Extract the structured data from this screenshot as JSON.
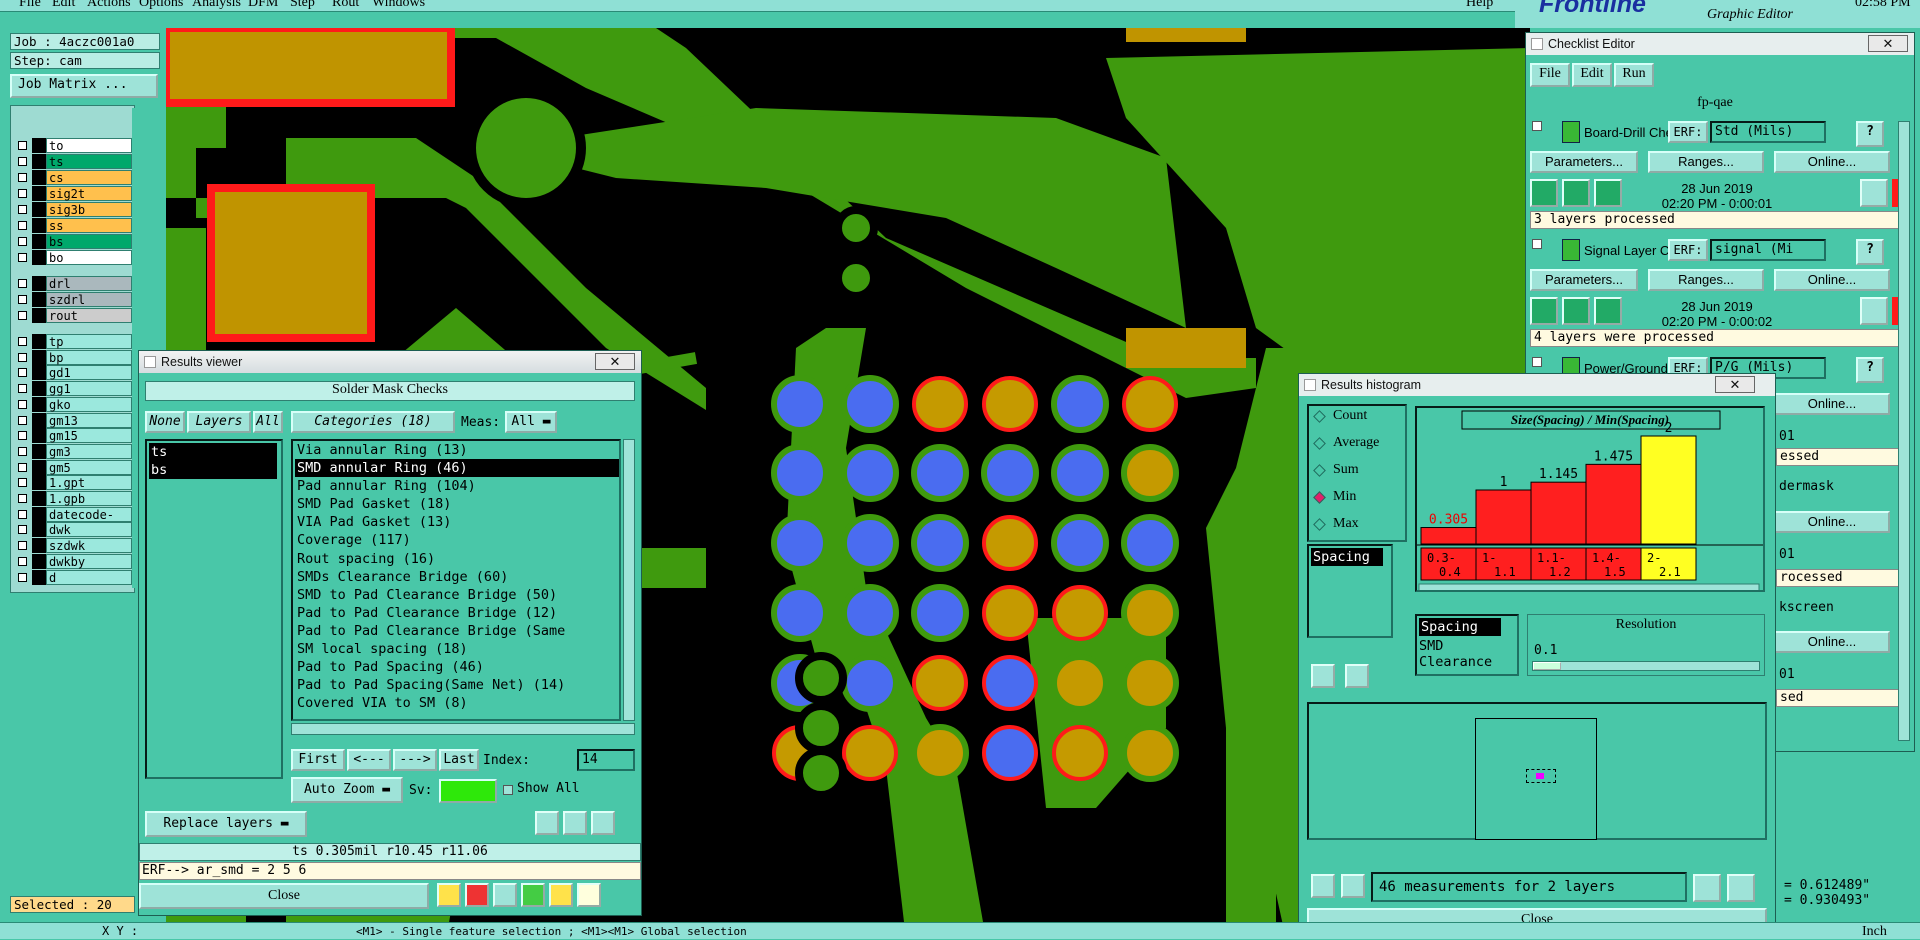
{
  "menubar": {
    "items": [
      "File",
      "Edit",
      "Actions",
      "Options",
      "Analysis",
      "DFM",
      "Step",
      "Rout",
      "Windows"
    ],
    "help": "Help",
    "brand": "Frontline",
    "subtitle": "Graphic Editor",
    "clock": "02:58 PM"
  },
  "left_panel": {
    "job": "Job : 4aczc001a0",
    "step": "Step: cam",
    "job_matrix_button": "Job Matrix ...",
    "selected": "Selected : 20",
    "layers_group1": [
      {
        "name": "to",
        "color": "#ffffff"
      },
      {
        "name": "ts",
        "color": "#00a86b"
      },
      {
        "name": "cs",
        "color": "#ffc04d"
      },
      {
        "name": "sig2t",
        "color": "#ffc04d"
      },
      {
        "name": "sig3b",
        "color": "#ffc04d"
      },
      {
        "name": "ss",
        "color": "#ffc04d"
      },
      {
        "name": "bs",
        "color": "#00a86b"
      },
      {
        "name": "bo",
        "color": "#ffffff"
      }
    ],
    "layers_group2": [
      {
        "name": "drl",
        "color": "#aab8bd"
      },
      {
        "name": "szdrl",
        "color": "#aab8bd"
      },
      {
        "name": "rout",
        "color": "#cccccc"
      }
    ],
    "layers_group3": [
      "tp",
      "bp",
      "gd1",
      "gg1",
      "gko",
      "gm13",
      "gm15",
      "gm3",
      "gm5",
      "1.gpt",
      "1.gpb",
      "datecode-pts",
      "dwk",
      "szdwk",
      "dwkby",
      "d"
    ]
  },
  "bottom_bar": {
    "hint": "<M1> - Single feature selection ; <M1><M1> Global selection",
    "xy_label": "X Y :",
    "units": "Inch",
    "coord_x": "= 0.612489\"",
    "coord_y": "= 0.930493\""
  },
  "results_viewer": {
    "title": "Results viewer",
    "header": "Solder Mask Checks",
    "none_btn": "None",
    "layers_btn": "Layers",
    "all_btn": "All",
    "categories_btn": "Categories (18)",
    "meas_label": "Meas:",
    "meas_value": "All",
    "layers": [
      "ts",
      "bs"
    ],
    "categories": [
      "Via annular Ring (13)",
      "SMD annular Ring (46)",
      "Pad annular Ring (104)",
      "SMD Pad Gasket (18)",
      "VIA Pad Gasket (13)",
      "Coverage (117)",
      "Rout spacing (16)",
      "SMDs Clearance Bridge (60)",
      "SMD to Pad Clearance Bridge (50)",
      "Pad to Pad Clearance Bridge (12)",
      "Pad to Pad Clearance Bridge (Same",
      "SM local spacing (18)",
      "Pad to Pad Spacing (46)",
      "Pad to Pad Spacing(Same Net) (14)",
      "Covered VIA to SM (8)"
    ],
    "selected_category": "SMD annular Ring (46)",
    "first": "First",
    "prev": "<---",
    "next": "--->",
    "last": "Last",
    "index_label": "Index:",
    "index_value": "14",
    "auto_zoom": "Auto Zoom",
    "sv_label": "Sv:",
    "show_all": "Show All",
    "replace_layers": "Replace layers",
    "info_line": "ts 0.305mil  r10.45  r11.06",
    "erf_line": "ERF--> ar_smd = 2 5 6",
    "close": "Close"
  },
  "checklist_editor": {
    "title": "Checklist Editor",
    "menu": [
      "File",
      "Edit",
      "Run"
    ],
    "name": "fp-qae",
    "checks": [
      {
        "name": "Board-Drill Che",
        "erf_label": "ERF:",
        "erf_value": "Std (Mils)",
        "params": "Parameters...",
        "ranges": "Ranges...",
        "online": "Online...",
        "date": "28 Jun 2019",
        "time": "02:20 PM - 0:00:01",
        "status": "3 layers processed"
      },
      {
        "name": "Signal Layer Ch",
        "erf_label": "ERF:",
        "erf_value": "signal (Mi",
        "params": "Parameters...",
        "ranges": "Ranges...",
        "online": "Online...",
        "date": "28 Jun 2019",
        "time": "02:20 PM - 0:00:02",
        "status": "4 layers were processed"
      },
      {
        "name": "Power/Ground C",
        "erf_label": "ERF:",
        "erf_value": "P/G (Mils)"
      }
    ],
    "partial": [
      "Online...",
      "01",
      "essed",
      "dermask",
      "Online...",
      "01",
      "rocessed",
      "kscreen",
      "Online...",
      "01",
      "sed"
    ]
  },
  "histogram": {
    "title": "Results histogram",
    "modes": [
      "Count",
      "Average",
      "Sum",
      "Min",
      "Max"
    ],
    "selected_mode": "Min",
    "measure_list": [
      "Spacing"
    ],
    "chart_title": "Size(Spacing) / Min(Spacing)",
    "legend_items": [
      "Spacing",
      "SMD",
      "Clearance"
    ],
    "resolution_label": "Resolution",
    "resolution_value": "0.1",
    "summary": "46 measurements for 2 layers",
    "close": "Close"
  },
  "chart_data": {
    "type": "bar",
    "title": "Size(Spacing) / Min(Spacing)",
    "categories": [
      "0.3-0.4",
      "1-1.1",
      "1.1-1.2",
      "1.4-1.5",
      "2-2.1"
    ],
    "values": [
      0.305,
      1,
      1.145,
      1.475,
      2
    ],
    "value_labels": [
      "0.305",
      "1",
      "1.145",
      "1.475",
      "2"
    ],
    "colors": [
      "#ff1f1f",
      "#ff1f1f",
      "#ff1f1f",
      "#ff1f1f",
      "#ffff22"
    ]
  }
}
